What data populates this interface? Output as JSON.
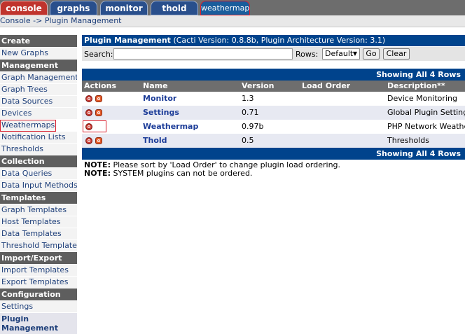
{
  "tabs": [
    {
      "label": "console"
    },
    {
      "label": "graphs"
    },
    {
      "label": "monitor"
    },
    {
      "label": "thold"
    },
    {
      "label": "weathermap"
    }
  ],
  "breadcrumb": {
    "text": "Console -> Plugin Management"
  },
  "sidebar": {
    "create": {
      "header": "Create",
      "items": [
        {
          "label": "New Graphs"
        }
      ]
    },
    "management": {
      "header": "Management",
      "items": [
        {
          "label": "Graph Management"
        },
        {
          "label": "Graph Trees"
        },
        {
          "label": "Data Sources"
        },
        {
          "label": "Devices"
        },
        {
          "label": "Weathermaps"
        },
        {
          "label": "Notification Lists"
        },
        {
          "label": "Thresholds"
        }
      ]
    },
    "collection": {
      "header": "Collection Methods",
      "items": [
        {
          "label": "Data Queries"
        },
        {
          "label": "Data Input Methods"
        }
      ]
    },
    "templates": {
      "header": "Templates",
      "items": [
        {
          "label": "Graph Templates"
        },
        {
          "label": "Host Templates"
        },
        {
          "label": "Data Templates"
        },
        {
          "label": "Threshold Templates"
        }
      ]
    },
    "import_export": {
      "header": "Import/Export",
      "items": [
        {
          "label": "Import Templates"
        },
        {
          "label": "Export Templates"
        }
      ]
    },
    "configuration": {
      "header": "Configuration",
      "items": [
        {
          "label": "Settings"
        },
        {
          "label": "Plugin Management"
        }
      ]
    }
  },
  "panel": {
    "title_bold": "Plugin Management",
    "title_rest": " (Cacti Version: 0.8.8b, Plugin Architecture Version: 3.1)"
  },
  "filter": {
    "search_label": "Search:",
    "search_value": "",
    "rows_label": "Rows:",
    "rows_value": "Default",
    "go_label": "Go",
    "clear_label": "Clear"
  },
  "table": {
    "nav_text": "Showing All 4 Rows",
    "headers": {
      "actions": "Actions",
      "name": "Name",
      "version": "Version",
      "load_order": "Load Order",
      "description": "Description**"
    },
    "rows": [
      {
        "name": "Monitor",
        "version": "1.3",
        "load_order": "",
        "description": "Device Monitoring"
      },
      {
        "name": "Settings",
        "version": "0.71",
        "load_order": "",
        "description": "Global Plugin Settings"
      },
      {
        "name": "Weathermap",
        "version": "0.97b",
        "load_order": "",
        "description": "PHP Network Weathermap"
      },
      {
        "name": "Thold",
        "version": "0.5",
        "load_order": "",
        "description": "Thresholds"
      }
    ]
  },
  "notes": [
    {
      "label": "NOTE:",
      "text": " Please sort by 'Load Order' to change plugin load ordering."
    },
    {
      "label": "NOTE:",
      "text": " SYSTEM plugins can not be ordered."
    }
  ],
  "colors": {
    "accent": "#00438c",
    "sidebar_header": "#5e5e5e",
    "tab_red": "#c0342d",
    "tab_blue": "#294f8c"
  }
}
